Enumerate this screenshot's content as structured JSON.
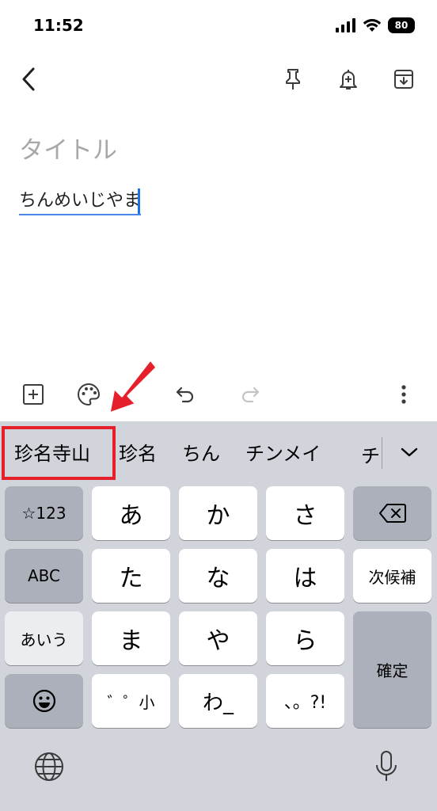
{
  "status_bar": {
    "time": "11:52",
    "battery": "80"
  },
  "note": {
    "title_placeholder": "タイトル",
    "body_text": "ちんめいじやま"
  },
  "keyboard": {
    "candidates": [
      "珍名寺山",
      "珍名",
      "ちん",
      "チンメイ",
      "チ"
    ],
    "keys": {
      "numbers": "☆123",
      "abc": "ABC",
      "aiu": "あいう",
      "a": "あ",
      "ka": "か",
      "sa": "さ",
      "ta": "た",
      "na": "な",
      "ha": "は",
      "ma": "ま",
      "ya": "や",
      "ra": "ら",
      "dakuten": "゛゜小",
      "wa": "わ_",
      "punct": "、。?!",
      "next_candidate": "次候補",
      "confirm": "確定"
    }
  },
  "colors": {
    "accent_blue": "#1a73e8",
    "highlight_red": "#e6202b",
    "keyboard_bg": "#d1d4db"
  }
}
